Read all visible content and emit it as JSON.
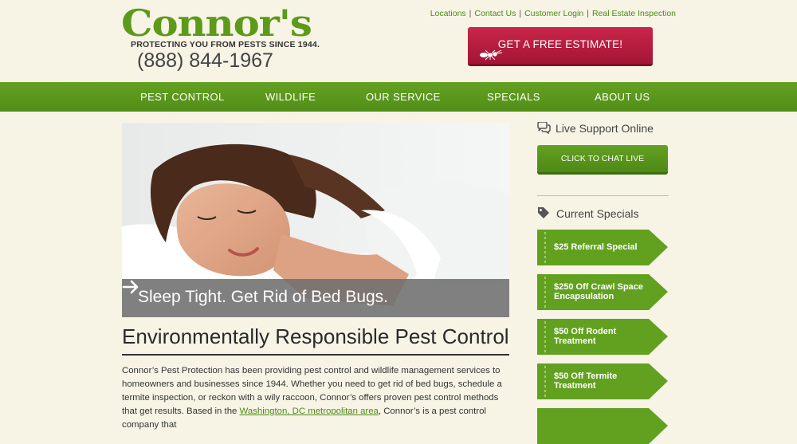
{
  "header": {
    "logo_text": "Connor's",
    "tagline": "PROTECTING YOU FROM PESTS SINCE 1944.",
    "phone": "(888) 844-1967",
    "top_links": [
      {
        "label": "Locations"
      },
      {
        "label": "Contact Us"
      },
      {
        "label": "Customer Login"
      },
      {
        "label": "Real Estate Inspection"
      }
    ],
    "estimate_button": "GET A FREE ESTIMATE!"
  },
  "nav": {
    "items": [
      {
        "label": "PEST CONTROL"
      },
      {
        "label": "WILDLIFE"
      },
      {
        "label": "OUR SERVICE"
      },
      {
        "label": "SPECIALS"
      },
      {
        "label": "ABOUT US"
      }
    ]
  },
  "hero": {
    "caption": "Sleep Tight. Get Rid of Bed Bugs."
  },
  "main": {
    "title": "Environmentally Responsible Pest Control",
    "intro_part1": "Connor’s Pest Protection has been providing pest control and wildlife management services to homeowners and businesses since 1944. Whether you need to get rid of bed bugs, schedule a termite inspection, or reckon with a wily raccoon, Connor’s offers proven pest control methods that get results. Based in the ",
    "intro_link": "Washington, DC metropolitan area",
    "intro_part2": ", Connor’s is a pest control company that"
  },
  "sidebar": {
    "support_heading": "Live Support Online",
    "chat_button": "CLICK TO CHAT LIVE",
    "specials_heading": "Current Specials",
    "specials": [
      {
        "label": "$25 Referral Special"
      },
      {
        "label": "$250 Off Crawl Space Encapsulation"
      },
      {
        "label": "$50 Off Rodent Treatment"
      },
      {
        "label": "$50 Off Termite Treatment"
      }
    ]
  },
  "colors": {
    "brand_green": "#5c9a1a",
    "estimate_red": "#b51c3d",
    "background": "#f7f4e6"
  }
}
